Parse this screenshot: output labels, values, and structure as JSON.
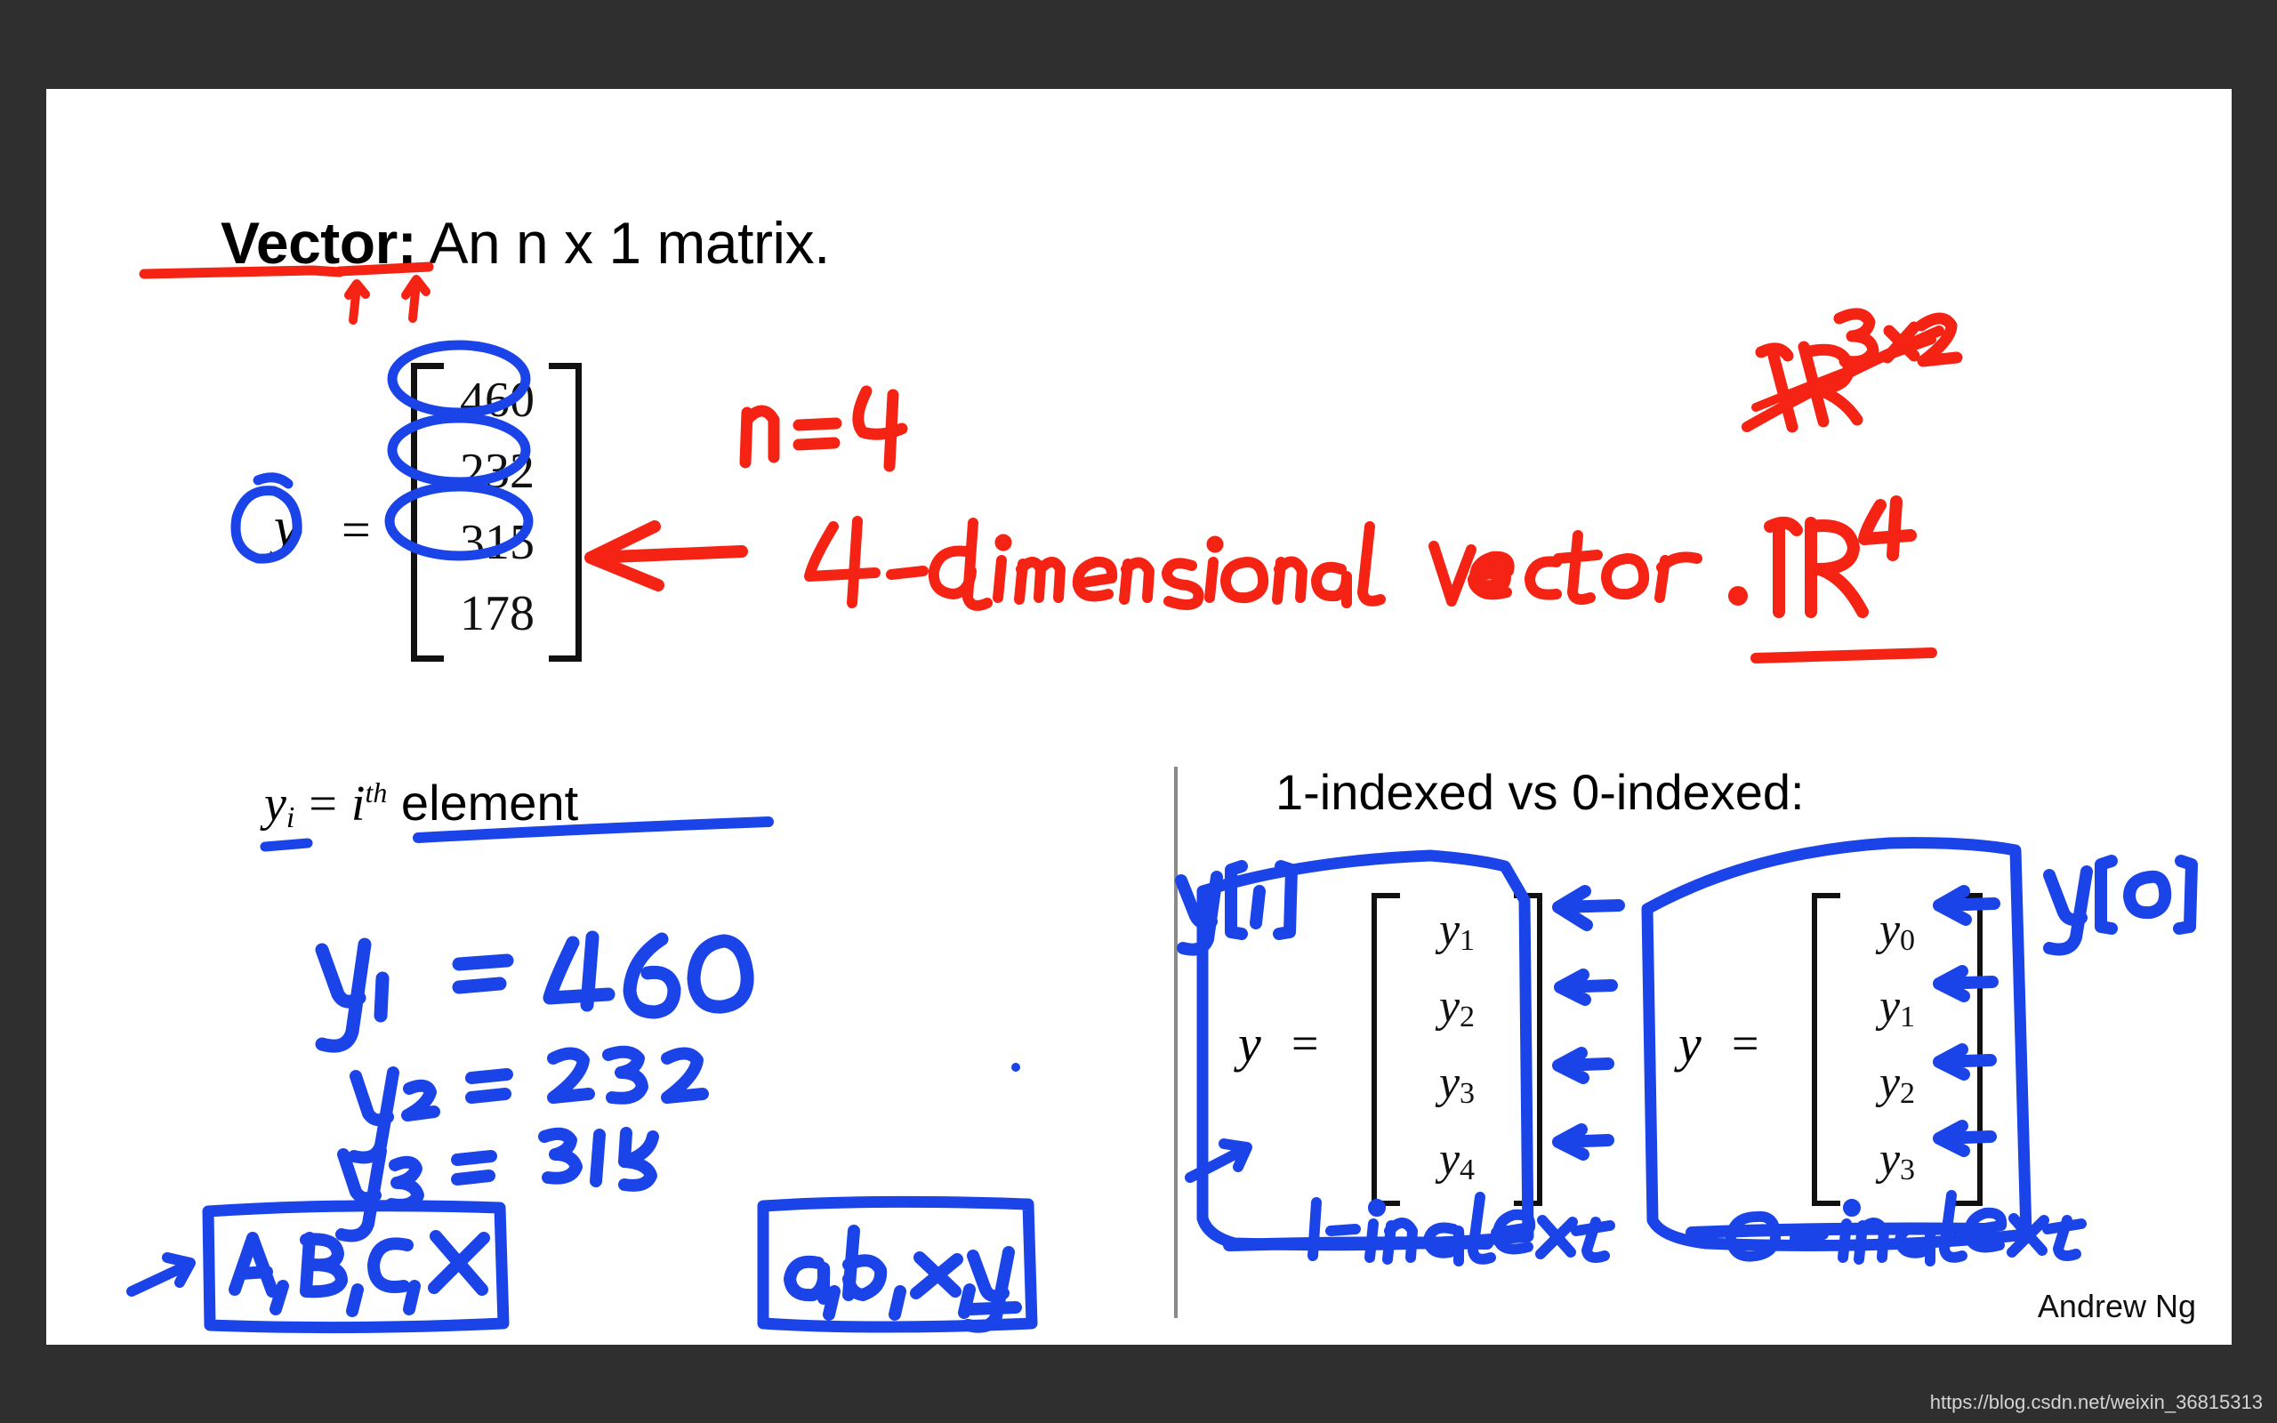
{
  "slide": {
    "title_bold": "Vector:",
    "title_rest": " An n x 1 matrix.",
    "author": "Andrew Ng"
  },
  "watermark": {
    "text": "https://blog.csdn.net/weixin_36815313"
  },
  "colors": {
    "background": "#2f2f2f",
    "slide": "#ffffff",
    "ink_red": "#f42314",
    "ink_blue": "#1a44e8",
    "text": "#111111",
    "divider": "#8a8a8a"
  },
  "vector": {
    "label": "y",
    "equals": "=",
    "values": [
      "460",
      "232",
      "315",
      "178"
    ],
    "circled": [
      "460",
      "232",
      "315"
    ]
  },
  "element_line": {
    "var": "y",
    "sub": "i",
    "equals": "=",
    "ith": "i",
    "ith_sup": "th",
    "word": " element"
  },
  "annotations_red": {
    "n_equals": "n= 4",
    "dimension_note": "4-dimensional vector .",
    "r_crossed": "R",
    "r_crossed_sup": "3x2",
    "r_four": "R",
    "r_four_sup": "4"
  },
  "annotations_blue": {
    "eq1": "y₁ = 460",
    "eq2": "y₂ = 232",
    "eq3": "y₃ = 315",
    "box_upper": "A, B, C, X",
    "box_lower": "a, b, x, y",
    "bracket_one": "y[i]",
    "bracket_zero": "y[0]",
    "label_one_indexed": "1-indexed",
    "label_zero_indexed": "0-indexed"
  },
  "indexed_section": {
    "heading": "1-indexed vs 0-indexed:",
    "one_indexed": {
      "label": "y",
      "equals": "=",
      "rows": [
        {
          "base": "y",
          "sub": "1"
        },
        {
          "base": "y",
          "sub": "2"
        },
        {
          "base": "y",
          "sub": "3"
        },
        {
          "base": "y",
          "sub": "4"
        }
      ]
    },
    "zero_indexed": {
      "label": "y",
      "equals": "=",
      "rows": [
        {
          "base": "y",
          "sub": "0"
        },
        {
          "base": "y",
          "sub": "1"
        },
        {
          "base": "y",
          "sub": "2"
        },
        {
          "base": "y",
          "sub": "3"
        }
      ]
    }
  }
}
